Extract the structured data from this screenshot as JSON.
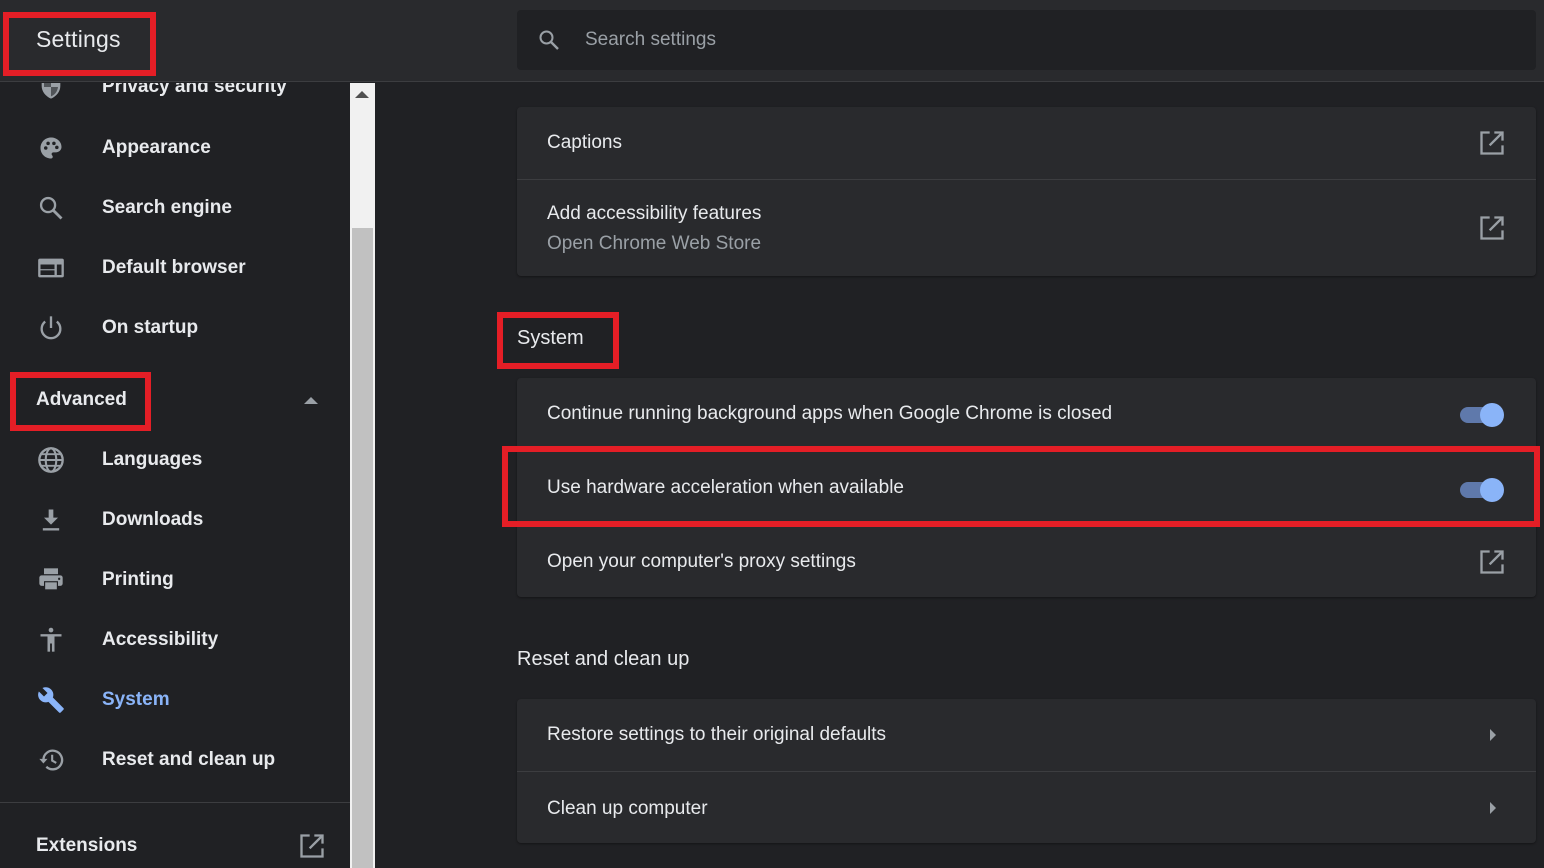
{
  "header": {
    "title": "Settings",
    "search": {
      "placeholder": "Search settings",
      "value": ""
    }
  },
  "sidebar": {
    "items": [
      {
        "label": "Privacy and security",
        "icon": "shield-icon"
      },
      {
        "label": "Appearance",
        "icon": "palette-icon"
      },
      {
        "label": "Search engine",
        "icon": "search-icon"
      },
      {
        "label": "Default browser",
        "icon": "browser-icon"
      },
      {
        "label": "On startup",
        "icon": "power-icon"
      }
    ],
    "advanced": {
      "label": "Advanced",
      "expanded": true
    },
    "advanced_items": [
      {
        "label": "Languages",
        "icon": "globe-icon"
      },
      {
        "label": "Downloads",
        "icon": "download-icon"
      },
      {
        "label": "Printing",
        "icon": "printer-icon"
      },
      {
        "label": "Accessibility",
        "icon": "accessibility-icon"
      },
      {
        "label": "System",
        "icon": "wrench-icon",
        "active": true
      },
      {
        "label": "Reset and clean up",
        "icon": "history-icon"
      }
    ],
    "extensions": {
      "label": "Extensions",
      "icon": "external-link-icon"
    }
  },
  "main": {
    "accessibility_card": {
      "rows": [
        {
          "title": "Captions",
          "icon": "external-link-icon"
        },
        {
          "title": "Add accessibility features",
          "subtitle": "Open Chrome Web Store",
          "icon": "external-link-icon"
        }
      ]
    },
    "system_section": {
      "heading": "System",
      "rows": [
        {
          "title": "Continue running background apps when Google Chrome is closed",
          "toggle": true
        },
        {
          "title": "Use hardware acceleration when available",
          "toggle": true
        },
        {
          "title": "Open your computer's proxy settings",
          "icon": "external-link-icon"
        }
      ]
    },
    "reset_section": {
      "heading": "Reset and clean up",
      "rows": [
        {
          "title": "Restore settings to their original defaults",
          "icon": "chevron-right-icon"
        },
        {
          "title": "Clean up computer",
          "icon": "chevron-right-icon"
        }
      ]
    }
  },
  "colors": {
    "accent": "#8ab4f8",
    "highlight": "#e41e26",
    "background": "#202124",
    "surface": "#292a2d"
  }
}
